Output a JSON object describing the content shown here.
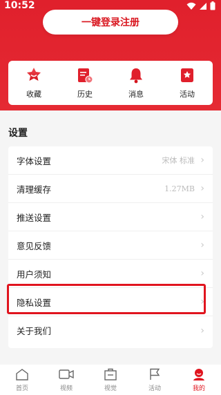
{
  "status_bar": {
    "time": "10:52"
  },
  "header": {
    "login_label": "一键登录注册"
  },
  "quick_actions": [
    {
      "label": "收藏",
      "icon": "favorite-icon"
    },
    {
      "label": "历史",
      "icon": "history-icon"
    },
    {
      "label": "消息",
      "icon": "bell-icon"
    },
    {
      "label": "活动",
      "icon": "activity-icon"
    }
  ],
  "settings": {
    "title": "设置",
    "rows": [
      {
        "label": "字体设置",
        "value": "宋体 标准"
      },
      {
        "label": "清理缓存",
        "value": "1.27MB"
      },
      {
        "label": "推送设置",
        "value": ""
      },
      {
        "label": "意见反馈",
        "value": ""
      },
      {
        "label": "用户须知",
        "value": ""
      },
      {
        "label": "隐私设置",
        "value": ""
      },
      {
        "label": "关于我们",
        "value": ""
      }
    ]
  },
  "bottom_nav": [
    {
      "label": "首页",
      "icon": "home-icon",
      "active": false
    },
    {
      "label": "视频",
      "icon": "video-icon",
      "active": false
    },
    {
      "label": "视觉",
      "icon": "vision-icon",
      "active": false
    },
    {
      "label": "活动",
      "icon": "flag-icon",
      "active": false
    },
    {
      "label": "我的",
      "icon": "profile-icon",
      "active": true
    }
  ],
  "colors": {
    "brand_red": "#e0202c",
    "highlight": "#e0141e"
  }
}
